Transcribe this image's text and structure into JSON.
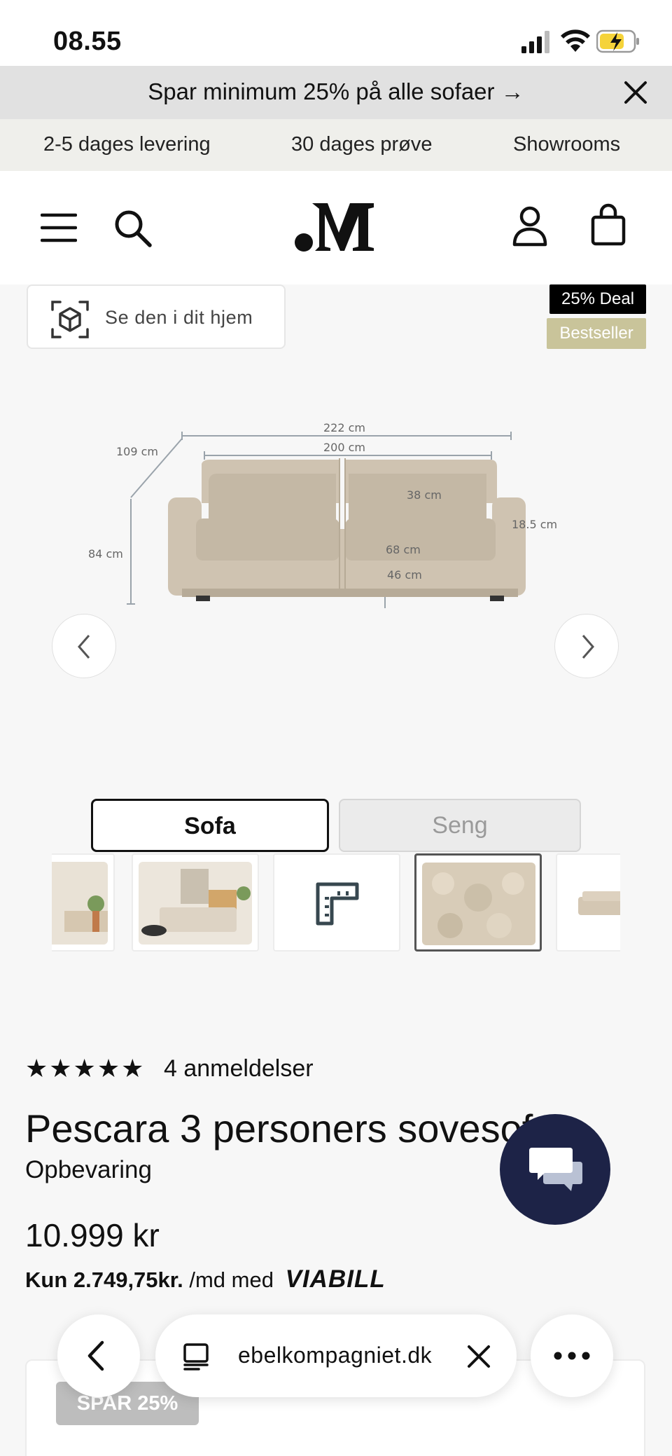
{
  "status_bar": {
    "time": "08.55",
    "battery_color": "#f5d33a"
  },
  "promo": {
    "text": "Spar minimum 25% på alle sofaer →"
  },
  "usp": {
    "items": [
      "2-5 dages levering",
      "30 dages prøve",
      "Showrooms"
    ]
  },
  "header": {
    "logo": ".M",
    "icons": [
      "menu-icon",
      "search-icon",
      "account-icon",
      "cart-icon"
    ]
  },
  "gallery": {
    "ar_button_label": "Se den i dit hjem",
    "badges": {
      "deal": "25% Deal",
      "bestseller": "Bestseller"
    },
    "dimensions": {
      "width_total": "222 cm",
      "width_seat": "200 cm",
      "depth": "109 cm",
      "height": "84 cm",
      "back_cushion": "38 cm",
      "arm": "18.5 cm",
      "seat_depth": "68 cm",
      "seat_height": "46 cm"
    }
  },
  "toggle": {
    "sofa": "Sofa",
    "seng": "Seng",
    "selected": "Sofa"
  },
  "thumbnails": {
    "items": [
      "living-room-photo",
      "living-room-bed-photo",
      "measurement-icon",
      "fabric-swatch",
      "sofa-photo"
    ],
    "active_index": 3
  },
  "product": {
    "stars": "★★★★★",
    "rating": 5,
    "reviews": "4 anmeldelser",
    "title": "Pescara 3 personers sovesofa",
    "subtitle": "Opbevaring",
    "price": "10.999 kr",
    "finance_amount": "Kun 2.749,75kr.",
    "finance_text": "/md med",
    "finance_provider": "VIABILL"
  },
  "card": {
    "badge": "SPAR 25%"
  },
  "browser": {
    "url": "ebelkompagniet.dk"
  },
  "colors": {
    "accent_dark": "#1d2347",
    "bestseller": "#c9c49a",
    "deal": "#000000"
  }
}
